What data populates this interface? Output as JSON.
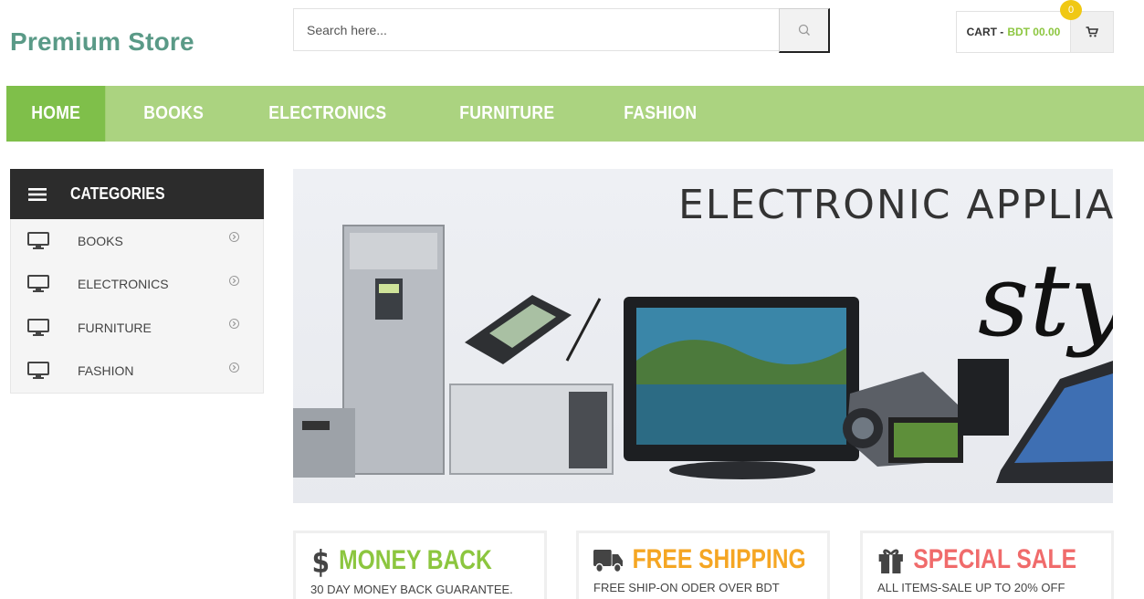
{
  "store": {
    "name": "Premium Store"
  },
  "search": {
    "placeholder": "Search here..."
  },
  "cart": {
    "label": "CART -",
    "amount": "BDT 00.00",
    "count": "0"
  },
  "nav": {
    "items": [
      {
        "label": "HOME",
        "active": true
      },
      {
        "label": "BOOKS"
      },
      {
        "label": "ELECTRONICS"
      },
      {
        "label": "FURNITURE"
      },
      {
        "label": "FASHION"
      }
    ]
  },
  "categories": {
    "title": "CATEGORIES",
    "items": [
      {
        "label": "BOOKS"
      },
      {
        "label": "ELECTRONICS"
      },
      {
        "label": "FURNITURE"
      },
      {
        "label": "FASHION"
      }
    ]
  },
  "banner": {
    "title": "ELECTRONIC APPLIAN",
    "script": "sty"
  },
  "features": [
    {
      "title": "MONEY BACK",
      "subtitle": "30 DAY MONEY BACK GUARANTEE.",
      "color": "#8cc63f",
      "icon": "dollar-icon"
    },
    {
      "title": "FREE SHIPPING",
      "subtitle": "FREE SHIP-ON ODER OVER BDT",
      "color": "#f5a623",
      "icon": "truck-icon"
    },
    {
      "title": "SPECIAL SALE",
      "subtitle": "ALL ITEMS-SALE UP TO 20% OFF",
      "color": "#f06b6b",
      "icon": "gift-icon"
    }
  ],
  "colors": {
    "brand": "#5a9a87",
    "nav": "#abd380",
    "nav_active": "#7fbf4a",
    "accent_green": "#8cc63f",
    "badge": "#f0c814"
  }
}
